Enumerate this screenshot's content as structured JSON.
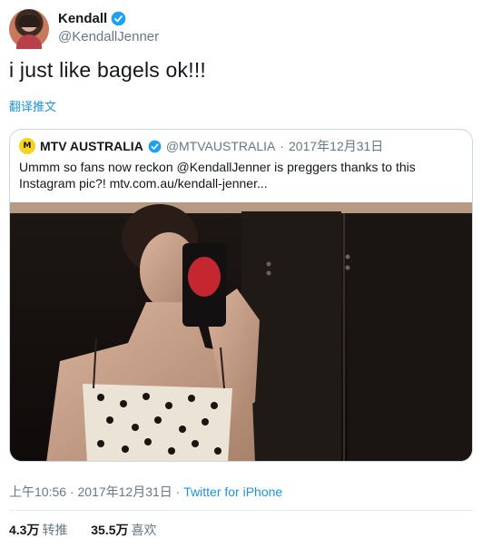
{
  "author": {
    "name": "Kendall",
    "handle": "@KendallJenner"
  },
  "tweet": {
    "text": "i just like bagels ok!!!",
    "translate_label": "翻译推文"
  },
  "quote": {
    "name": "MTV AUSTRALIA",
    "handle": "@MTVAUSTRALIA",
    "separator": "·",
    "date": "2017年12月31日",
    "text": "Ummm so fans now reckon @KendallJenner is preggers thanks to this Instagram pic?! mtv.com.au/kendall-jenner...",
    "logo_text": "M"
  },
  "meta": {
    "time": "上午10:56",
    "separator1": " · ",
    "date": "2017年12月31日",
    "separator2": " · ",
    "source": "Twitter for iPhone"
  },
  "stats": {
    "retweets_count": "4.3万",
    "retweets_label": "转推",
    "likes_count": "35.5万",
    "likes_label": "喜欢"
  },
  "colors": {
    "link": "#1b95e0",
    "verified": "#1da1f2",
    "muted": "#657786"
  }
}
